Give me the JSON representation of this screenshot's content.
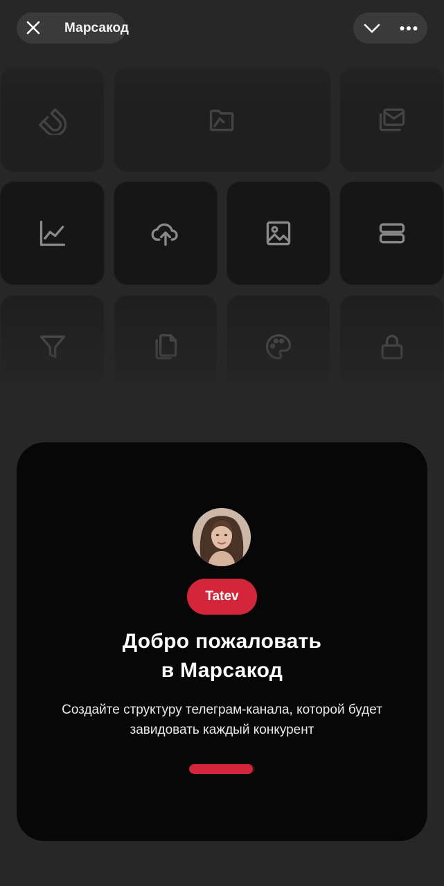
{
  "header": {
    "title": "Марсакод",
    "close_icon": "close-icon",
    "collapse_icon": "chevron-down-icon",
    "more_icon": "more-dots-icon"
  },
  "background_icons": [
    "magnet-icon",
    "folder-icon",
    "mail-stack-icon",
    "chart-line-icon",
    "cloud-upload-icon",
    "image-icon",
    "layers-stack-icon",
    "filter-icon",
    "copy-document-icon",
    "palette-icon",
    "lock-icon"
  ],
  "card": {
    "name_badge": "Tatev",
    "headline_line1": "Добро пожаловать",
    "headline_line2": "в Марсакод",
    "subtitle": "Создайте структуру телеграм-канала, которой будет завидовать каждый конкурент",
    "progress_fraction": 0.97
  },
  "colors": {
    "background": "#272727",
    "card": "#070707",
    "accent": "#d3263a",
    "pill": "#3a3a3a"
  }
}
